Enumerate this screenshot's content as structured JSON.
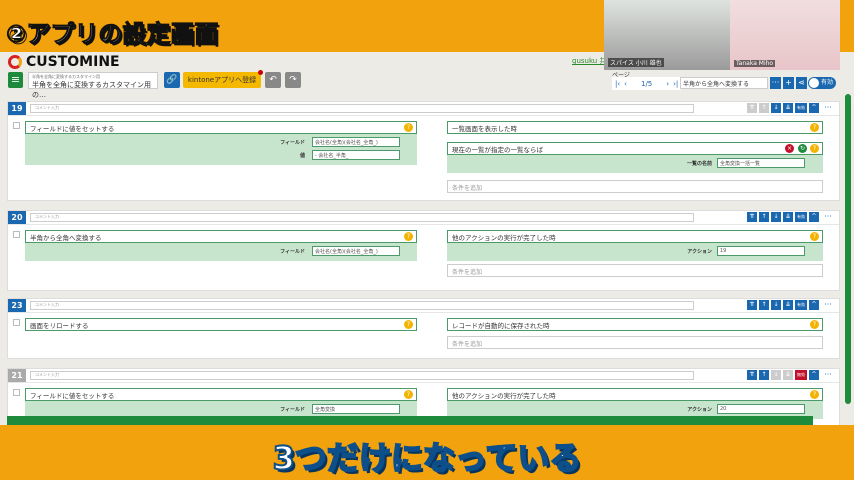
{
  "banner": {
    "title": "②アプリの設定画面",
    "caption": "3つだけになっている"
  },
  "video": {
    "left_name": "スパイス 小川 雄也",
    "right_name": "Tanaka Miho"
  },
  "header": {
    "logo": "CUSTOMINE",
    "link": "gusuku 共",
    "app_label": "半角を全角に変換するカスタマイン用",
    "app_name": "半角を全角に変換するカスタマイン用 の…",
    "register": "kintoneアプリへ登録",
    "page_label": "ページ",
    "page": "1/5",
    "search_value": "半角から全角へ変換する",
    "toggle": "有効"
  },
  "rules": [
    {
      "num": "19",
      "comment": "コメント入力",
      "enabled": true,
      "action": {
        "title": "フィールドに値をセットする",
        "fields": [
          {
            "label": "フィールド",
            "value": "会社名(全角)(会社名_全角_)"
          },
          {
            "label": "値",
            "value": "- 会社名_半角_"
          }
        ]
      },
      "trigger": {
        "title": "一覧画面を表示した時"
      },
      "condition": {
        "title": "現在の一覧が指定の一覧ならば",
        "fields": [
          {
            "label": "一覧の名前",
            "value": "全角変換一括一覧"
          }
        ]
      },
      "add": "条件を追加"
    },
    {
      "num": "20",
      "comment": "コメント入力",
      "enabled": true,
      "action": {
        "title": "半角から全角へ変換する",
        "fields": [
          {
            "label": "フィールド",
            "value": "会社名(全角)(会社名_全角_)"
          }
        ]
      },
      "trigger": {
        "title": "他のアクションの実行が完了した時",
        "fields": [
          {
            "label": "アクション",
            "value": "19"
          }
        ]
      },
      "add": "条件を追加"
    },
    {
      "num": "23",
      "comment": "コメント入力",
      "enabled": true,
      "action": {
        "title": "画面をリロードする",
        "fields": []
      },
      "trigger": {
        "title": "レコードが自動的に保存された時",
        "fields": []
      },
      "add": "条件を追加"
    },
    {
      "num": "21",
      "comment": "コメント入力",
      "enabled": false,
      "action": {
        "title": "フィールドに値をセットする",
        "fields": [
          {
            "label": "フィールド",
            "value": "全角変換"
          }
        ]
      },
      "trigger": {
        "title": "他のアクションの実行が完了した時",
        "fields": [
          {
            "label": "アクション",
            "value": "20"
          }
        ]
      }
    }
  ],
  "labels": {
    "enabled": "有効",
    "disabled": "無効"
  },
  "colors": {
    "accent": "#1a68b0",
    "green": "#1e8a3c",
    "banner": "#f2a20c"
  }
}
